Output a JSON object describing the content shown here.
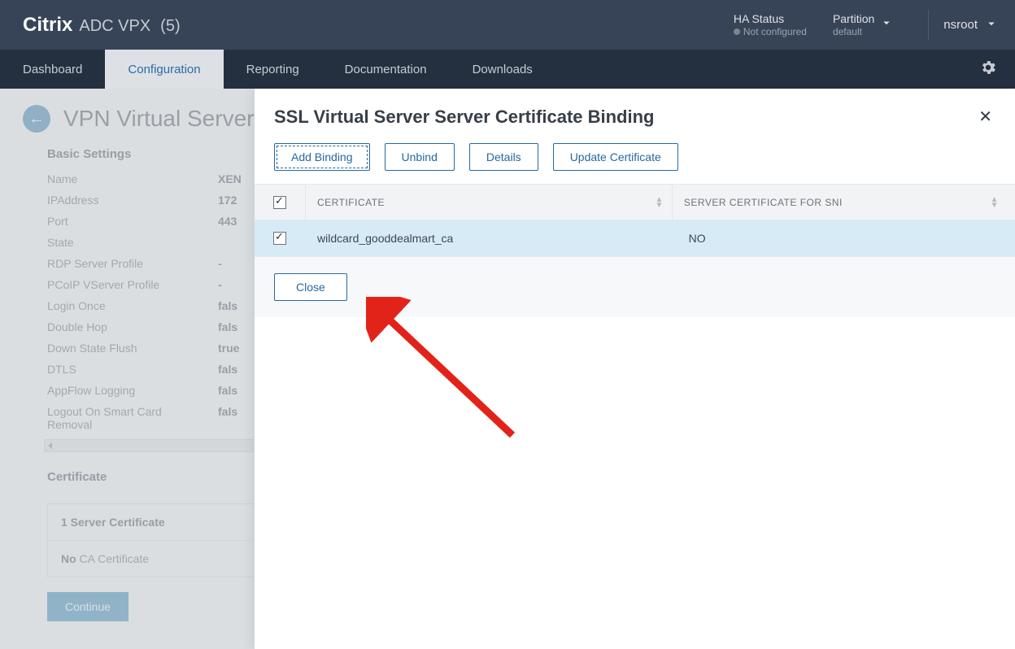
{
  "brand": {
    "main": "Citrix",
    "sub": "ADC VPX",
    "count": "(5)"
  },
  "top": {
    "ha_label": "HA Status",
    "ha_value": "Not configured",
    "partition_label": "Partition",
    "partition_value": "default",
    "user": "nsroot"
  },
  "nav": {
    "dashboard": "Dashboard",
    "configuration": "Configuration",
    "reporting": "Reporting",
    "documentation": "Documentation",
    "downloads": "Downloads"
  },
  "bg": {
    "title": "VPN Virtual Server",
    "basic_settings": "Basic Settings",
    "rows": [
      {
        "k": "Name",
        "v": "XEN"
      },
      {
        "k": "IPAddress",
        "v": "172"
      },
      {
        "k": "Port",
        "v": "443"
      },
      {
        "k": "State",
        "v": ""
      },
      {
        "k": "RDP Server Profile",
        "v": "-"
      },
      {
        "k": "PCoIP VServer Profile",
        "v": "-"
      },
      {
        "k": "Login Once",
        "v": "fals"
      },
      {
        "k": "Double Hop",
        "v": "fals"
      },
      {
        "k": "Down State Flush",
        "v": "true"
      },
      {
        "k": "DTLS",
        "v": "fals"
      },
      {
        "k": "AppFlow Logging",
        "v": "fals"
      },
      {
        "k": "Logout On Smart Card Removal",
        "v": "fals"
      }
    ],
    "certificate_heading": "Certificate",
    "server_cert_count": "1",
    "server_cert_label": " Server Certificate",
    "ca_cert_prefix": "No",
    "ca_cert_label": " CA Certificate",
    "continue": "Continue"
  },
  "panel": {
    "title": "SSL Virtual Server Server Certificate Binding",
    "btn_add": "Add Binding",
    "btn_unbind": "Unbind",
    "btn_details": "Details",
    "btn_update": "Update Certificate",
    "th_certificate": "CERTIFICATE",
    "th_sni": "SERVER CERTIFICATE FOR SNI",
    "row_cert": "wildcard_gooddealmart_ca",
    "row_sni": "NO",
    "close": "Close"
  }
}
